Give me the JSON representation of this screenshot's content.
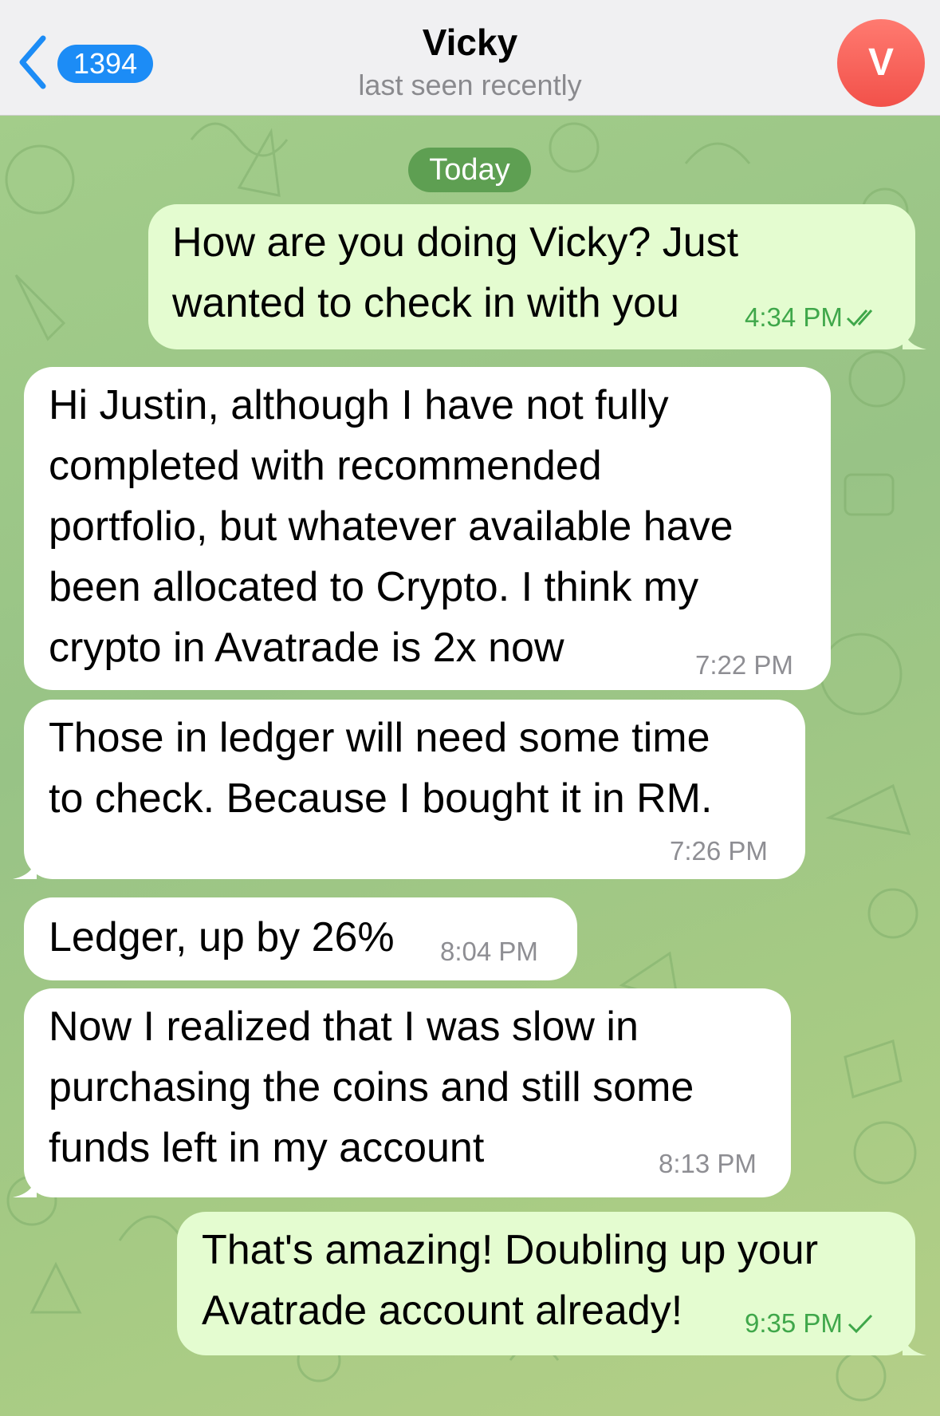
{
  "header": {
    "back_count": "1394",
    "contact_name": "Vicky",
    "status": "last seen recently",
    "avatar_initial": "V"
  },
  "chat": {
    "date_divider": "Today",
    "messages": [
      {
        "direction": "outgoing",
        "lines": [
          "How are you doing Vicky? Just",
          "wanted to check in with you"
        ],
        "time": "4:34 PM",
        "status": "read"
      },
      {
        "direction": "incoming",
        "lines": [
          "Hi Justin, although I have not fully",
          "completed with recommended",
          "portfolio, but whatever available have",
          "been allocated to Crypto. I think my",
          "crypto in Avatrade is 2x now"
        ],
        "time": "7:22 PM"
      },
      {
        "direction": "incoming",
        "lines": [
          "Those in ledger will need some time",
          "to check. Because I bought it in RM."
        ],
        "time": "7:26 PM"
      },
      {
        "direction": "incoming",
        "lines": [
          "Ledger, up by 26%"
        ],
        "time": "8:04 PM"
      },
      {
        "direction": "incoming",
        "lines": [
          "Now I realized that I was slow in",
          "purchasing the coins and still some",
          "funds left in my account"
        ],
        "time": "8:13 PM"
      },
      {
        "direction": "outgoing",
        "lines": [
          "That's amazing! Doubling up your",
          "Avatrade account already!"
        ],
        "time": "9:35 PM",
        "status": "delivered"
      }
    ]
  },
  "colors": {
    "accent": "#1c8cf6",
    "outgoing_bubble": "#e4fcd0",
    "incoming_bubble": "#ffffff",
    "outgoing_time": "#3fa74a",
    "avatar": "#f2514a",
    "date_pill": "#5e9f52"
  },
  "icons": {
    "back": "chevron-left-icon",
    "read_receipt": "double-check-icon",
    "delivered_receipt": "single-check-icon"
  }
}
